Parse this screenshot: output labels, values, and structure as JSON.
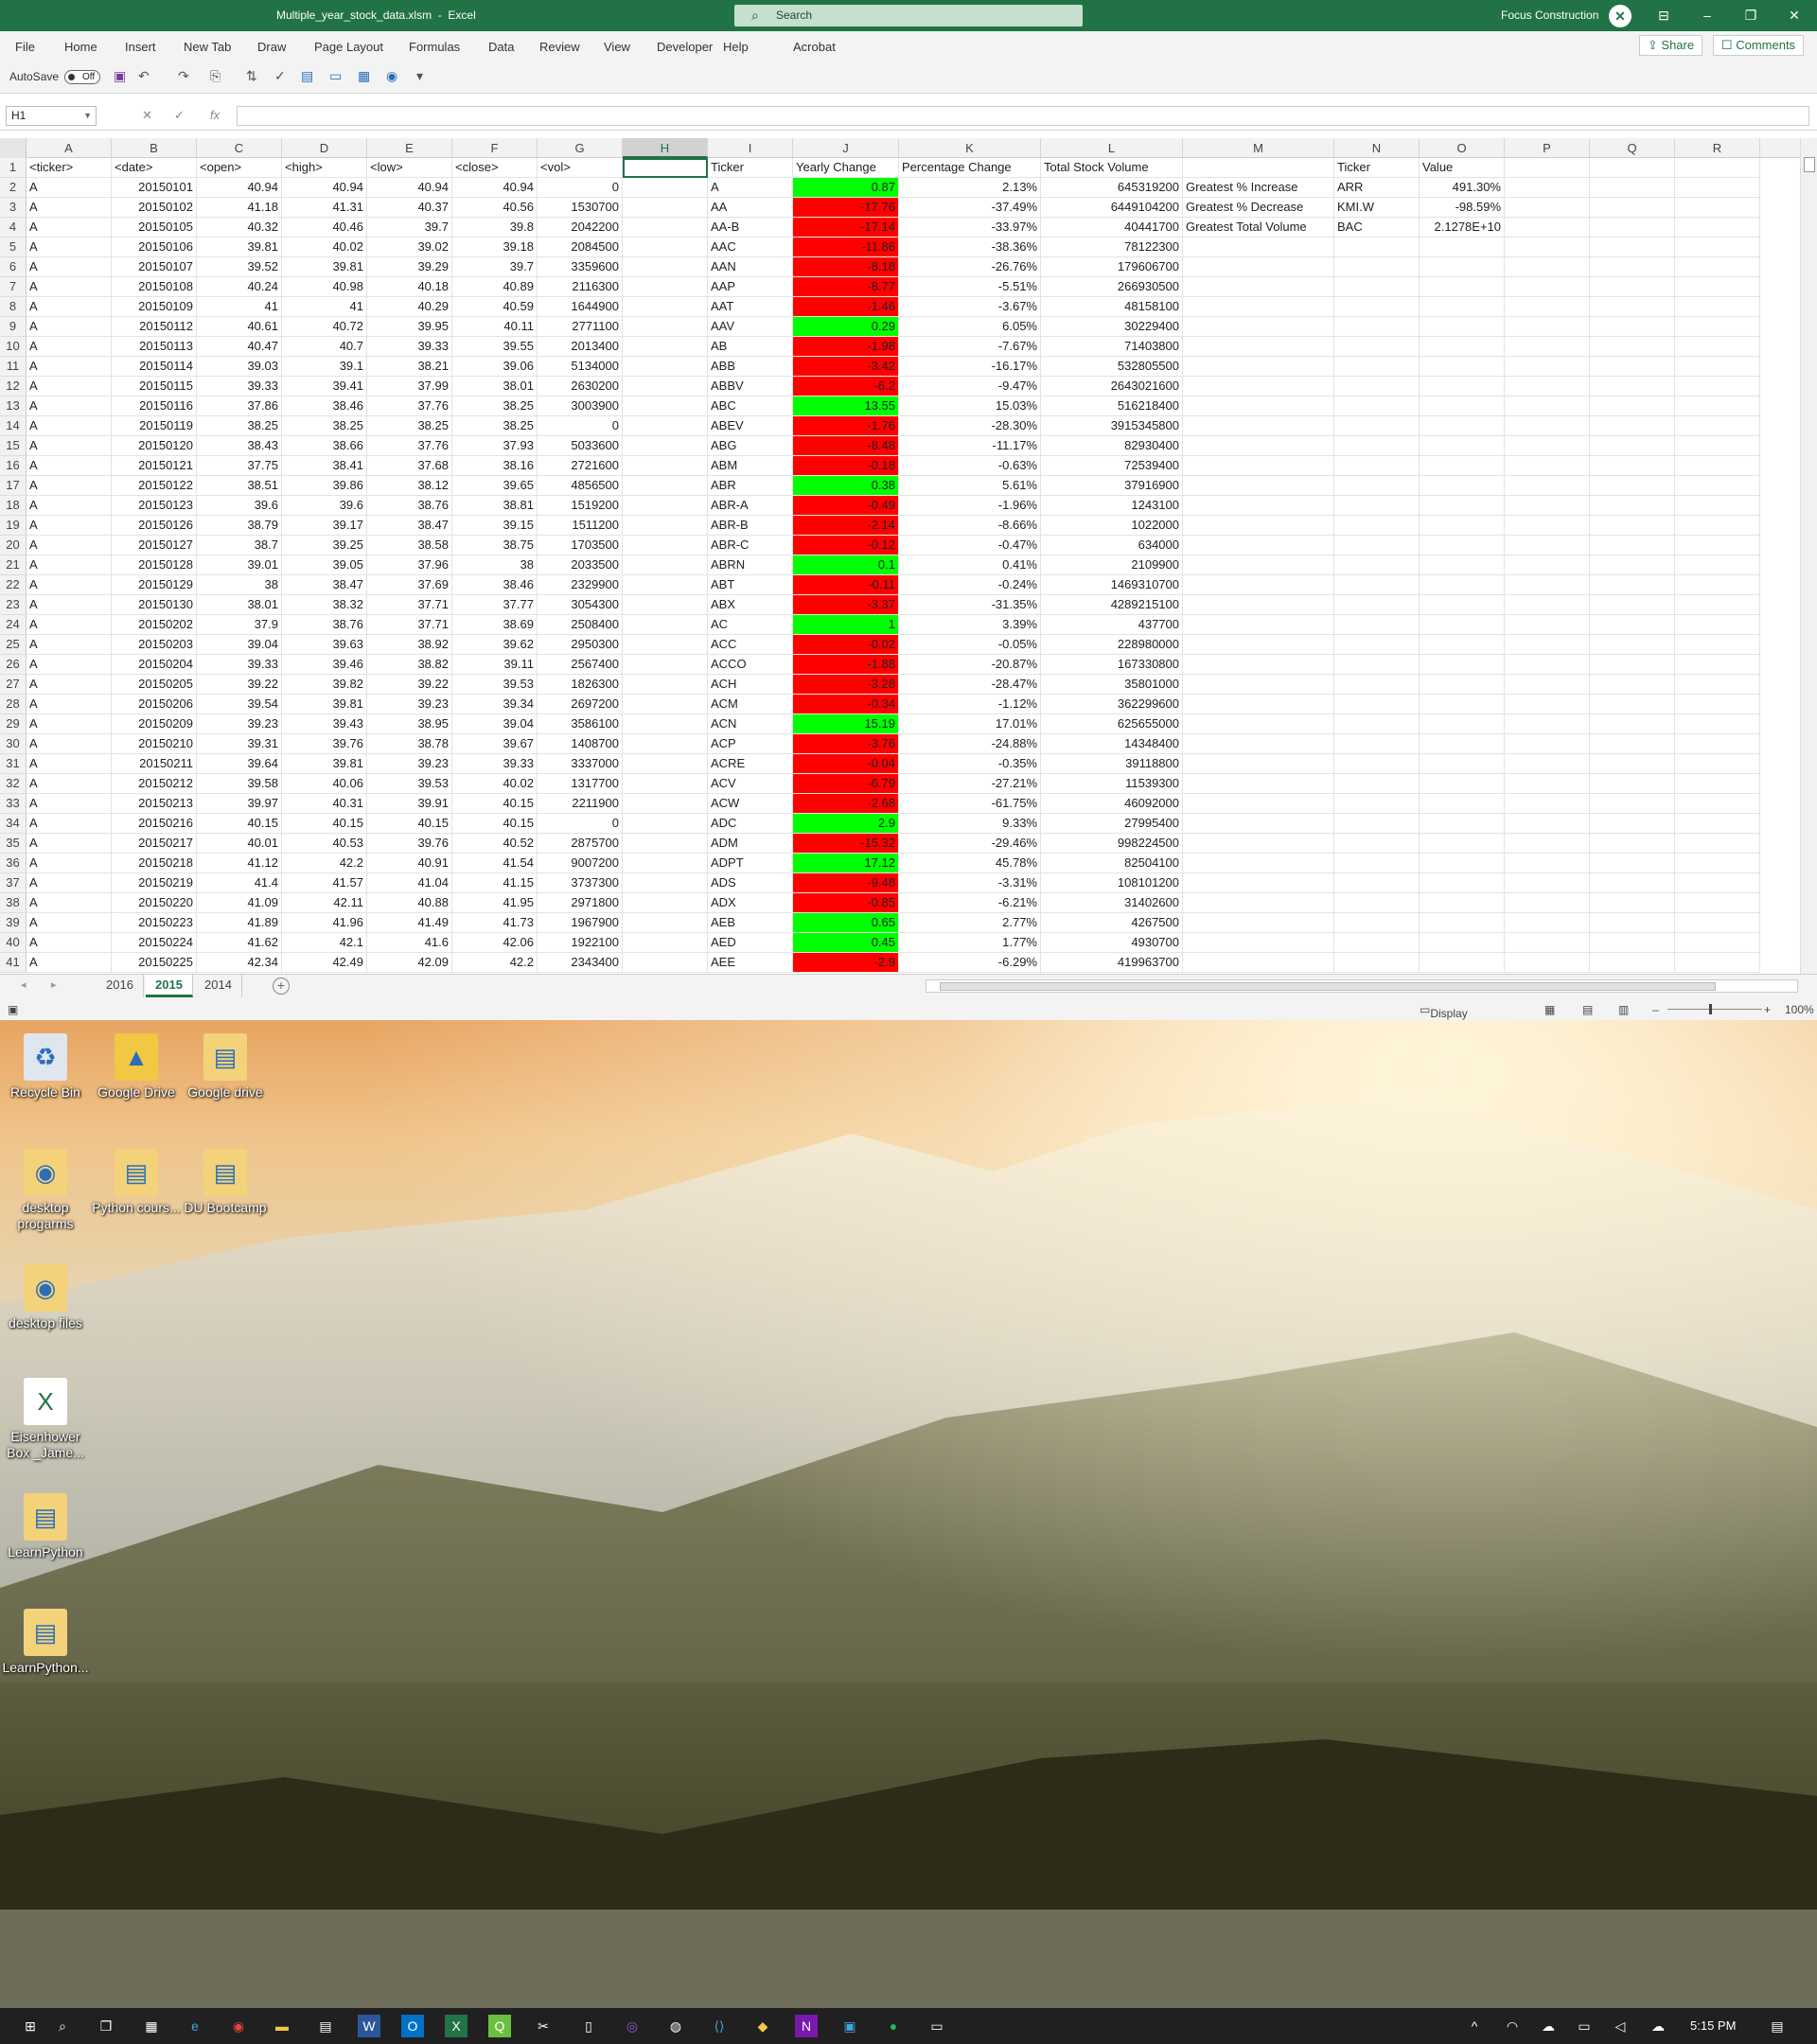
{
  "titlebar": {
    "title": "Multiple_year_stock_data.xlsm  -  Excel",
    "search": "Search",
    "user": "Focus Construction"
  },
  "menu": [
    "File",
    "Home",
    "Insert",
    "New Tab",
    "Draw",
    "Page Layout",
    "Formulas",
    "Data",
    "Review",
    "View",
    "Developer",
    "Help",
    "Acrobat"
  ],
  "share_label": "Share",
  "comments_label": "Comments",
  "autosave": {
    "label": "AutoSave",
    "state": "Off"
  },
  "namebox": "H1",
  "fx": "fx",
  "columns": [
    "A",
    "B",
    "C",
    "D",
    "E",
    "F",
    "G",
    "H",
    "I",
    "J",
    "K",
    "L",
    "M",
    "N",
    "O",
    "P",
    "Q",
    "R"
  ],
  "grid": {
    "headers": {
      "A": "<ticker>",
      "B": "<date>",
      "C": "<open>",
      "D": "<high>",
      "E": "<low>",
      "F": "<close>",
      "G": "<vol>",
      "I": "Ticker",
      "J": "Yearly Change",
      "K": "Percentage Change",
      "L": "Total Stock Volume",
      "N": "Ticker",
      "O": "Value"
    },
    "rows": [
      [
        "A",
        "20150101",
        "40.94",
        "40.94",
        "40.94",
        "40.94",
        "0",
        "A",
        "0.87",
        "2.13%",
        "645319200"
      ],
      [
        "A",
        "20150102",
        "41.18",
        "41.31",
        "40.37",
        "40.56",
        "1530700",
        "AA",
        "-17.76",
        "-37.49%",
        "6449104200"
      ],
      [
        "A",
        "20150105",
        "40.32",
        "40.46",
        "39.7",
        "39.8",
        "2042200",
        "AA-B",
        "-17.14",
        "-33.97%",
        "40441700"
      ],
      [
        "A",
        "20150106",
        "39.81",
        "40.02",
        "39.02",
        "39.18",
        "2084500",
        "AAC",
        "-11.86",
        "-38.36%",
        "78122300"
      ],
      [
        "A",
        "20150107",
        "39.52",
        "39.81",
        "39.29",
        "39.7",
        "3359600",
        "AAN",
        "-8.18",
        "-26.76%",
        "179606700"
      ],
      [
        "A",
        "20150108",
        "40.24",
        "40.98",
        "40.18",
        "40.89",
        "2116300",
        "AAP",
        "-8.77",
        "-5.51%",
        "266930500"
      ],
      [
        "A",
        "20150109",
        "41",
        "41",
        "40.29",
        "40.59",
        "1644900",
        "AAT",
        "-1.46",
        "-3.67%",
        "48158100"
      ],
      [
        "A",
        "20150112",
        "40.61",
        "40.72",
        "39.95",
        "40.11",
        "2771100",
        "AAV",
        "0.29",
        "6.05%",
        "30229400"
      ],
      [
        "A",
        "20150113",
        "40.47",
        "40.7",
        "39.33",
        "39.55",
        "2013400",
        "AB",
        "-1.98",
        "-7.67%",
        "71403800"
      ],
      [
        "A",
        "20150114",
        "39.03",
        "39.1",
        "38.21",
        "39.06",
        "5134000",
        "ABB",
        "-3.42",
        "-16.17%",
        "532805500"
      ],
      [
        "A",
        "20150115",
        "39.33",
        "39.41",
        "37.99",
        "38.01",
        "2630200",
        "ABBV",
        "-6.2",
        "-9.47%",
        "2643021600"
      ],
      [
        "A",
        "20150116",
        "37.86",
        "38.46",
        "37.76",
        "38.25",
        "3003900",
        "ABC",
        "13.55",
        "15.03%",
        "516218400"
      ],
      [
        "A",
        "20150119",
        "38.25",
        "38.25",
        "38.25",
        "38.25",
        "0",
        "ABEV",
        "-1.76",
        "-28.30%",
        "3915345800"
      ],
      [
        "A",
        "20150120",
        "38.43",
        "38.66",
        "37.76",
        "37.93",
        "5033600",
        "ABG",
        "-8.48",
        "-11.17%",
        "82930400"
      ],
      [
        "A",
        "20150121",
        "37.75",
        "38.41",
        "37.68",
        "38.16",
        "2721600",
        "ABM",
        "-0.18",
        "-0.63%",
        "72539400"
      ],
      [
        "A",
        "20150122",
        "38.51",
        "39.86",
        "38.12",
        "39.65",
        "4856500",
        "ABR",
        "0.38",
        "5.61%",
        "37916900"
      ],
      [
        "A",
        "20150123",
        "39.6",
        "39.6",
        "38.76",
        "38.81",
        "1519200",
        "ABR-A",
        "-0.49",
        "-1.96%",
        "1243100"
      ],
      [
        "A",
        "20150126",
        "38.79",
        "39.17",
        "38.47",
        "39.15",
        "1511200",
        "ABR-B",
        "-2.14",
        "-8.66%",
        "1022000"
      ],
      [
        "A",
        "20150127",
        "38.7",
        "39.25",
        "38.58",
        "38.75",
        "1703500",
        "ABR-C",
        "-0.12",
        "-0.47%",
        "634000"
      ],
      [
        "A",
        "20150128",
        "39.01",
        "39.05",
        "37.96",
        "38",
        "2033500",
        "ABRN",
        "0.1",
        "0.41%",
        "2109900"
      ],
      [
        "A",
        "20150129",
        "38",
        "38.47",
        "37.69",
        "38.46",
        "2329900",
        "ABT",
        "-0.11",
        "-0.24%",
        "1469310700"
      ],
      [
        "A",
        "20150130",
        "38.01",
        "38.32",
        "37.71",
        "37.77",
        "3054300",
        "ABX",
        "-3.37",
        "-31.35%",
        "4289215100"
      ],
      [
        "A",
        "20150202",
        "37.9",
        "38.76",
        "37.71",
        "38.69",
        "2508400",
        "AC",
        "1",
        "3.39%",
        "437700"
      ],
      [
        "A",
        "20150203",
        "39.04",
        "39.63",
        "38.92",
        "39.62",
        "2950300",
        "ACC",
        "-0.02",
        "-0.05%",
        "228980000"
      ],
      [
        "A",
        "20150204",
        "39.33",
        "39.46",
        "38.82",
        "39.11",
        "2567400",
        "ACCO",
        "-1.88",
        "-20.87%",
        "167330800"
      ],
      [
        "A",
        "20150205",
        "39.22",
        "39.82",
        "39.22",
        "39.53",
        "1826300",
        "ACH",
        "-3.28",
        "-28.47%",
        "35801000"
      ],
      [
        "A",
        "20150206",
        "39.54",
        "39.81",
        "39.23",
        "39.34",
        "2697200",
        "ACM",
        "-0.34",
        "-1.12%",
        "362299600"
      ],
      [
        "A",
        "20150209",
        "39.23",
        "39.43",
        "38.95",
        "39.04",
        "3586100",
        "ACN",
        "15.19",
        "17.01%",
        "625655000"
      ],
      [
        "A",
        "20150210",
        "39.31",
        "39.76",
        "38.78",
        "39.67",
        "1408700",
        "ACP",
        "-3.76",
        "-24.88%",
        "14348400"
      ],
      [
        "A",
        "20150211",
        "39.64",
        "39.81",
        "39.23",
        "39.33",
        "3337000",
        "ACRE",
        "-0.04",
        "-0.35%",
        "39118800"
      ],
      [
        "A",
        "20150212",
        "39.58",
        "40.06",
        "39.53",
        "40.02",
        "1317700",
        "ACV",
        "-6.79",
        "-27.21%",
        "11539300"
      ],
      [
        "A",
        "20150213",
        "39.97",
        "40.31",
        "39.91",
        "40.15",
        "2211900",
        "ACW",
        "-2.68",
        "-61.75%",
        "46092000"
      ],
      [
        "A",
        "20150216",
        "40.15",
        "40.15",
        "40.15",
        "40.15",
        "0",
        "ADC",
        "2.9",
        "9.33%",
        "27995400"
      ],
      [
        "A",
        "20150217",
        "40.01",
        "40.53",
        "39.76",
        "40.52",
        "2875700",
        "ADM",
        "-15.32",
        "-29.46%",
        "998224500"
      ],
      [
        "A",
        "20150218",
        "41.12",
        "42.2",
        "40.91",
        "41.54",
        "9007200",
        "ADPT",
        "17.12",
        "45.78%",
        "82504100"
      ],
      [
        "A",
        "20150219",
        "41.4",
        "41.57",
        "41.04",
        "41.15",
        "3737300",
        "ADS",
        "-9.48",
        "-3.31%",
        "108101200"
      ],
      [
        "A",
        "20150220",
        "41.09",
        "42.11",
        "40.88",
        "41.95",
        "2971800",
        "ADX",
        "-0.85",
        "-6.21%",
        "31402600"
      ],
      [
        "A",
        "20150223",
        "41.89",
        "41.96",
        "41.49",
        "41.73",
        "1967900",
        "AEB",
        "0.65",
        "2.77%",
        "4267500"
      ],
      [
        "A",
        "20150224",
        "41.62",
        "42.1",
        "41.6",
        "42.06",
        "1922100",
        "AED",
        "0.45",
        "1.77%",
        "4930700"
      ],
      [
        "A",
        "20150225",
        "42.34",
        "42.49",
        "42.09",
        "42.2",
        "2343400",
        "AEE",
        "-2.9",
        "-6.29%",
        "419963700"
      ]
    ],
    "summary": [
      {
        "label": "Greatest % Increase",
        "ticker": "ARR",
        "value": "491.30%"
      },
      {
        "label": "Greatest % Decrease",
        "ticker": "KMI.W",
        "value": "-98.59%"
      },
      {
        "label": "Greatest Total Volume",
        "ticker": "BAC",
        "value": "2.1278E+10"
      }
    ],
    "colors": {
      "positive": "#00ff00",
      "negative": "#ff0000"
    }
  },
  "sheets": [
    "2016",
    "2015",
    "2014"
  ],
  "active_sheet": "2015",
  "status": {
    "display_settings": "Display Settings",
    "zoom": "100%"
  },
  "desktop_icons": [
    {
      "label": "Recycle Bin",
      "icon": "recycle-bin-icon"
    },
    {
      "label": "Google Drive",
      "icon": "google-drive-icon"
    },
    {
      "label": "Google drive",
      "icon": "folder-icon"
    },
    {
      "label": "desktop progarms",
      "icon": "chrome-folder-icon"
    },
    {
      "label": "Python cours...",
      "icon": "folder-icon"
    },
    {
      "label": "DU Bootcamp",
      "icon": "folder-icon"
    },
    {
      "label": "desktop files",
      "icon": "chrome-folder-icon"
    },
    {
      "label": "Eisenhower Box _Jame...",
      "icon": "excel-file-icon"
    },
    {
      "label": "LearnPython",
      "icon": "folder-icon"
    },
    {
      "label": "LearnPython...",
      "icon": "folder-icon"
    }
  ],
  "taskbar": {
    "time": "5:15 PM"
  }
}
